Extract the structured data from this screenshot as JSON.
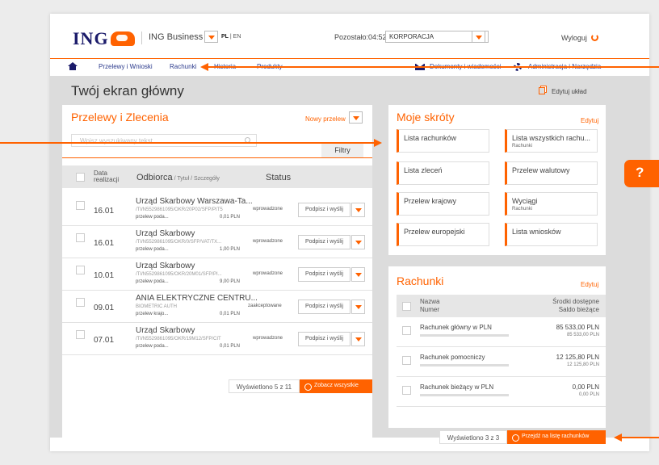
{
  "header": {
    "logo": "ING",
    "business": "ING Business",
    "lang_pl": "PL",
    "lang_sep": " | ",
    "lang_en": "EN",
    "timer": "Pozostało:04:52",
    "company": "KORPORACJA",
    "logout": "Wyloguj"
  },
  "nav": {
    "items": [
      "Przelewy i Wnioski",
      "Rachunki",
      "Historia",
      "Produkty"
    ],
    "documents": "Dokumenty i wiadomości",
    "admin": "Administracja i Narzędzia"
  },
  "page": {
    "title": "Twój ekran główny",
    "edit_layout": "Edytuj układ"
  },
  "transfers": {
    "title": "Przelewy i Zlecenia",
    "new_transfer": "Nowy przelew",
    "search_placeholder": "Wpisz wyszukiwany tekst",
    "filters": "Filtry",
    "col_date_1": "Data",
    "col_date_2": "realizacji",
    "col_recipient": "Odbiorca",
    "col_recipient_sub": " / Tytuł / Szczegóły",
    "col_status": "Status",
    "sign_label": "Podpisz i wyślij",
    "rows": [
      {
        "date": "16.01",
        "name": "Urząd Skarbowy Warszawa-Ta...",
        "account": "/TI/N5529861095/OKR/20P02/SFP/PIT5",
        "title": "przelew poda...",
        "amount": "0,01 PLN",
        "status": "wprowadzone"
      },
      {
        "date": "16.01",
        "name": "Urząd Skarbowy",
        "account": "/TI/N5529861095/OKR/0/SFP/VAT/TX...",
        "title": "przelew poda...",
        "amount": "1,00 PLN",
        "status": "wprowadzone"
      },
      {
        "date": "10.01",
        "name": "Urząd Skarbowy",
        "account": "/TI/N5529861095/OKR/20M01/SFP/PI...",
        "title": "przelew poda...",
        "amount": "9,00 PLN",
        "status": "wprowadzone"
      },
      {
        "date": "09.01",
        "name": "ANIA ELEKTRYCZNE CENTRU...",
        "account": "BIOMETRIC AUTH",
        "title": "przelew krajo...",
        "amount": "0,01 PLN",
        "status": "zaakceptowane"
      },
      {
        "date": "07.01",
        "name": "Urząd Skarbowy",
        "account": "/TI/N5529861095/OKR/19M12/SFP/CIT",
        "title": "przelew poda...",
        "amount": "0,01 PLN",
        "status": "wprowadzone"
      }
    ],
    "shown": "Wyświetlono 5 z 11",
    "see_all": "Zobacz wszystkie"
  },
  "shortcuts": {
    "title": "Moje skróty",
    "edit": "Edytuj",
    "items": [
      {
        "l1": "Lista rachunków",
        "l2": ""
      },
      {
        "l1": "Lista wszystkich rachu...",
        "l2": "Rachunki"
      },
      {
        "l1": "Lista zleceń",
        "l2": ""
      },
      {
        "l1": "Przelew walutowy",
        "l2": ""
      },
      {
        "l1": "Przelew krajowy",
        "l2": ""
      },
      {
        "l1": "Wyciągi",
        "l2": "Rachunki"
      },
      {
        "l1": "Przelew europejski",
        "l2": ""
      },
      {
        "l1": "Lista wniosków",
        "l2": ""
      }
    ]
  },
  "accounts": {
    "title": "Rachunki",
    "edit": "Edytuj",
    "col_name": "Nazwa",
    "col_number": "Numer",
    "col_funds": "Środki dostępne",
    "col_balance": "Saldo bieżące",
    "rows": [
      {
        "name": "Rachunek główny w PLN",
        "available": "85 533,00 PLN",
        "balance": "85 533,00 PLN"
      },
      {
        "name": "Rachunek pomocniczy",
        "available": "12 125,80 PLN",
        "balance": "12 125,80 PLN"
      },
      {
        "name": "Rachunek bieżący w PLN",
        "available": "0,00 PLN",
        "balance": "0,00 PLN"
      }
    ],
    "shown": "Wyświetlono 3 z 3",
    "goto": "Przejdź na listę rachunków"
  },
  "help": "?",
  "colors": {
    "accent": "#ff6200",
    "brand": "#1c1c6b"
  }
}
